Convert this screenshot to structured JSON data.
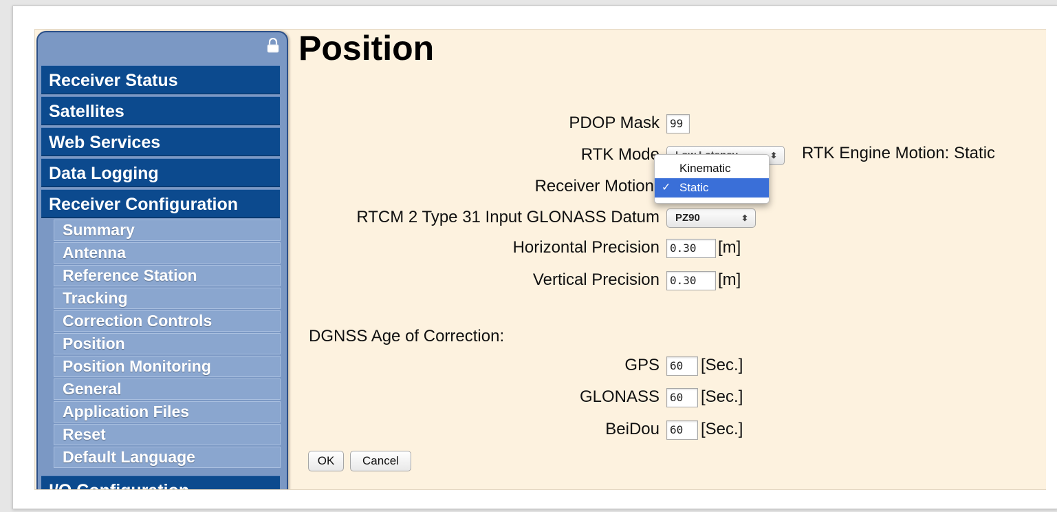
{
  "sidebar": {
    "main_items": [
      {
        "label": "Receiver Status"
      },
      {
        "label": "Satellites"
      },
      {
        "label": "Web Services"
      },
      {
        "label": "Data Logging"
      },
      {
        "label": "Receiver Configuration"
      }
    ],
    "sub_items": [
      {
        "label": "Summary"
      },
      {
        "label": "Antenna"
      },
      {
        "label": "Reference Station"
      },
      {
        "label": "Tracking"
      },
      {
        "label": "Correction Controls"
      },
      {
        "label": "Position"
      },
      {
        "label": "Position Monitoring"
      },
      {
        "label": "General"
      },
      {
        "label": "Application Files"
      },
      {
        "label": "Reset"
      },
      {
        "label": "Default Language"
      }
    ],
    "bottom_item": {
      "label": "I/O Configuration"
    }
  },
  "page": {
    "title": "Position"
  },
  "form": {
    "pdop_mask": {
      "label": "PDOP Mask",
      "value": "99"
    },
    "rtk_mode": {
      "label": "RTK Mode",
      "value": "Low Latency"
    },
    "rtk_engine_motion": {
      "label": "RTK Engine Motion: Static"
    },
    "receiver_motion": {
      "label": "Receiver Motion",
      "options": [
        "Kinematic",
        "Static"
      ],
      "selected": "Static",
      "check": "✓"
    },
    "rtcm_datum": {
      "label": "RTCM 2 Type 31 Input GLONASS Datum",
      "value": "PZ90"
    },
    "horizontal_precision": {
      "label": "Horizontal Precision",
      "value": "0.30",
      "unit": "[m]"
    },
    "vertical_precision": {
      "label": "Vertical Precision",
      "value": "0.30",
      "unit": "[m]"
    },
    "dgnss_heading": "DGNSS Age of Correction:",
    "gps": {
      "label": "GPS",
      "value": "60",
      "unit": "[Sec.]"
    },
    "glonass": {
      "label": "GLONASS",
      "value": "60",
      "unit": "[Sec.]"
    },
    "beidou": {
      "label": "BeiDou",
      "value": "60",
      "unit": "[Sec.]"
    },
    "ok_label": "OK",
    "cancel_label": "Cancel"
  },
  "colors": {
    "sidebar_main": "#0c4a8e",
    "sidebar_sub": "#8aa6cf",
    "content_bg": "#fdf2df",
    "selection": "#3a6fd8"
  }
}
